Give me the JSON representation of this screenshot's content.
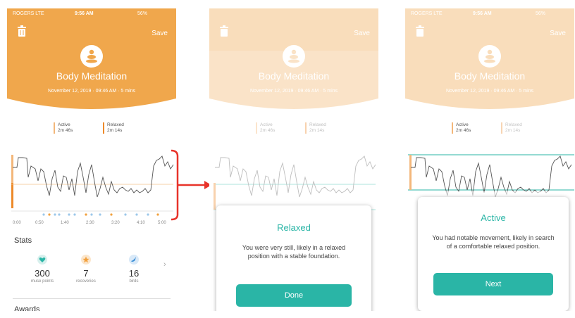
{
  "session": {
    "status_carrier": "ROGERS LTE",
    "status_time": "9:56 AM",
    "status_battery": "56%",
    "save_label": "Save",
    "title": "Body Meditation",
    "subtitle": "November 12, 2019 · 09:46 AM · 5 mins"
  },
  "legend": {
    "active_label": "Active",
    "active_time": "2m 46s",
    "relaxed_label": "Relaxed",
    "relaxed_time": "2m 14s"
  },
  "time_ticks": [
    "0:00",
    "0:50",
    "1:40",
    "2:30",
    "3:20",
    "4:10",
    "5:00"
  ],
  "stats": {
    "title": "Stats",
    "items": [
      {
        "value": "300",
        "label": "muse points",
        "icon": "heart-icon",
        "color": "#2ab5a6"
      },
      {
        "value": "7",
        "label": "recoveries",
        "icon": "star-icon",
        "color": "#f2a03d"
      },
      {
        "value": "16",
        "label": "birds",
        "icon": "bird-icon",
        "color": "#3b8fd6"
      }
    ]
  },
  "awards_title": "Awards",
  "relaxed_modal": {
    "title": "Relaxed",
    "body": "You were very still, likely in a relaxed position with a stable foundation.",
    "button": "Done"
  },
  "active_modal": {
    "title": "Active",
    "body": "You had notable movement, likely in search of a comfortable relaxed position.",
    "button": "Next"
  },
  "colors": {
    "header_orange": "#f0a74c",
    "teal": "#2ab5a6",
    "arrow_red": "#e8332a"
  }
}
